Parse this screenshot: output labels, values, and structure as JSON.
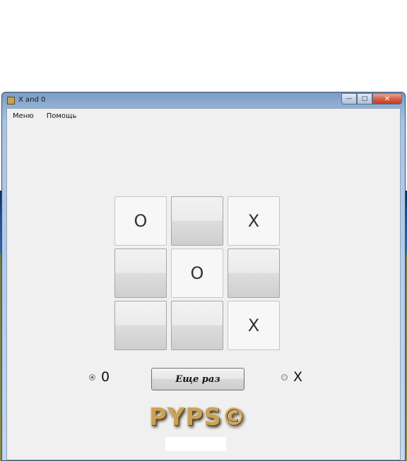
{
  "window": {
    "title": "X and 0"
  },
  "menu": {
    "items": [
      "Меню",
      "Помощь"
    ]
  },
  "board": {
    "cells": [
      "O",
      "",
      "X",
      "",
      "O",
      "",
      "",
      "",
      "X"
    ]
  },
  "controls": {
    "radio_o_label": "0",
    "radio_x_label": "X",
    "selected": "0",
    "again_label": "Еще раз"
  },
  "logo": {
    "text": "PYPS©"
  },
  "colors": {
    "client_bg": "#f0f0f0",
    "titlebar": "#a9c4e3",
    "logo": "#c9a25a"
  },
  "icons": {
    "minimize": "minimize-icon",
    "maximize": "maximize-icon",
    "close": "close-icon"
  }
}
